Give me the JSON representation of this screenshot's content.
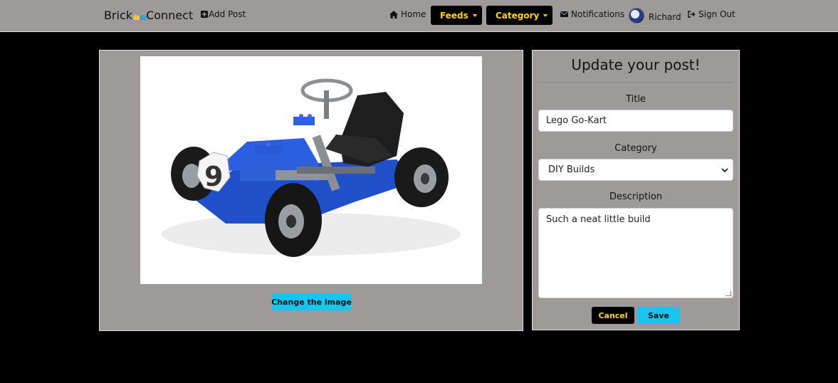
{
  "navbar": {
    "brand_left": "Brick",
    "brand_right": "Connect",
    "add_post": "Add Post",
    "home": "Home",
    "feeds": "Feeds",
    "category": "Category",
    "notifications": "Notifications",
    "user": "Richard",
    "sign_out": "Sign Out"
  },
  "image_panel": {
    "image_alt": "Lego Go-Kart",
    "change_image": "Change the image"
  },
  "form": {
    "heading": "Update your post!",
    "title_label": "Title",
    "title_value": "Lego Go-Kart",
    "category_label": "Category",
    "category_value": "DIY Builds",
    "description_label": "Description",
    "description_value": "Such a neat little build",
    "cancel": "Cancel",
    "save": "Save"
  },
  "colors": {
    "navbar_bg": "#9e9a9a",
    "panel_bg": "#9e9a9a",
    "accent_yellow": "#ffd700",
    "accent_cyan": "#17c6f0",
    "page_bg": "#000000"
  },
  "icons": {
    "add_post": "plus-square-icon",
    "home": "home-icon",
    "feeds": "list-icon",
    "category": "layers-icon",
    "notifications": "envelope-icon",
    "sign_out": "sign-out-icon"
  }
}
